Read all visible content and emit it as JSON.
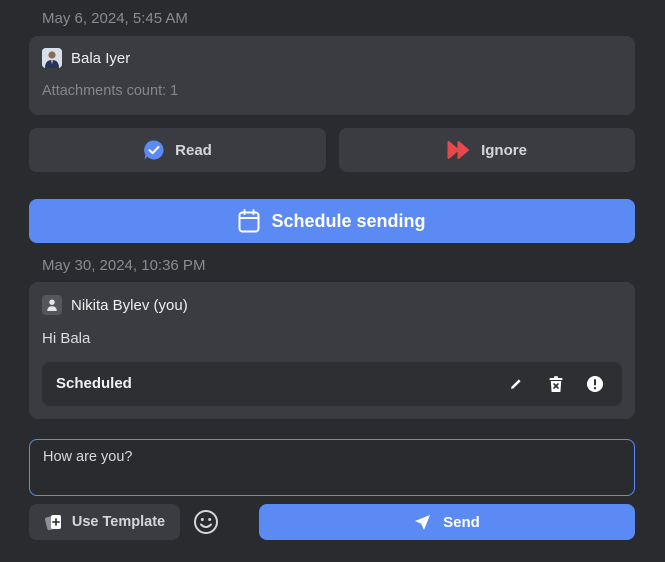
{
  "message1": {
    "timestamp": "May 6, 2024, 5:45 AM",
    "sender": "Bala Iyer",
    "attachments": "Attachments count: 1"
  },
  "actions": {
    "read_label": "Read",
    "ignore_label": "Ignore",
    "schedule_label": "Schedule sending"
  },
  "message2": {
    "timestamp": "May 30, 2024, 10:36 PM",
    "sender": "Nikita Bylev (you)",
    "body": "Hi Bala",
    "status": "Scheduled"
  },
  "composer": {
    "value": "How are you?",
    "template_label": "Use Template",
    "send_label": "Send"
  },
  "colors": {
    "accent": "#5b8af5",
    "ignore": "#e5484d",
    "background": "#2a2b2f",
    "card": "#3b3c41"
  },
  "icons": {
    "read": "chat-bubble-check-icon",
    "ignore": "fast-forward-icon",
    "schedule": "calendar-icon",
    "edit": "pencil-icon",
    "delete": "trash-icon",
    "info": "exclamation-circle-icon",
    "template": "cards-plus-icon",
    "emoji": "smiley-icon",
    "send": "paper-plane-icon"
  }
}
